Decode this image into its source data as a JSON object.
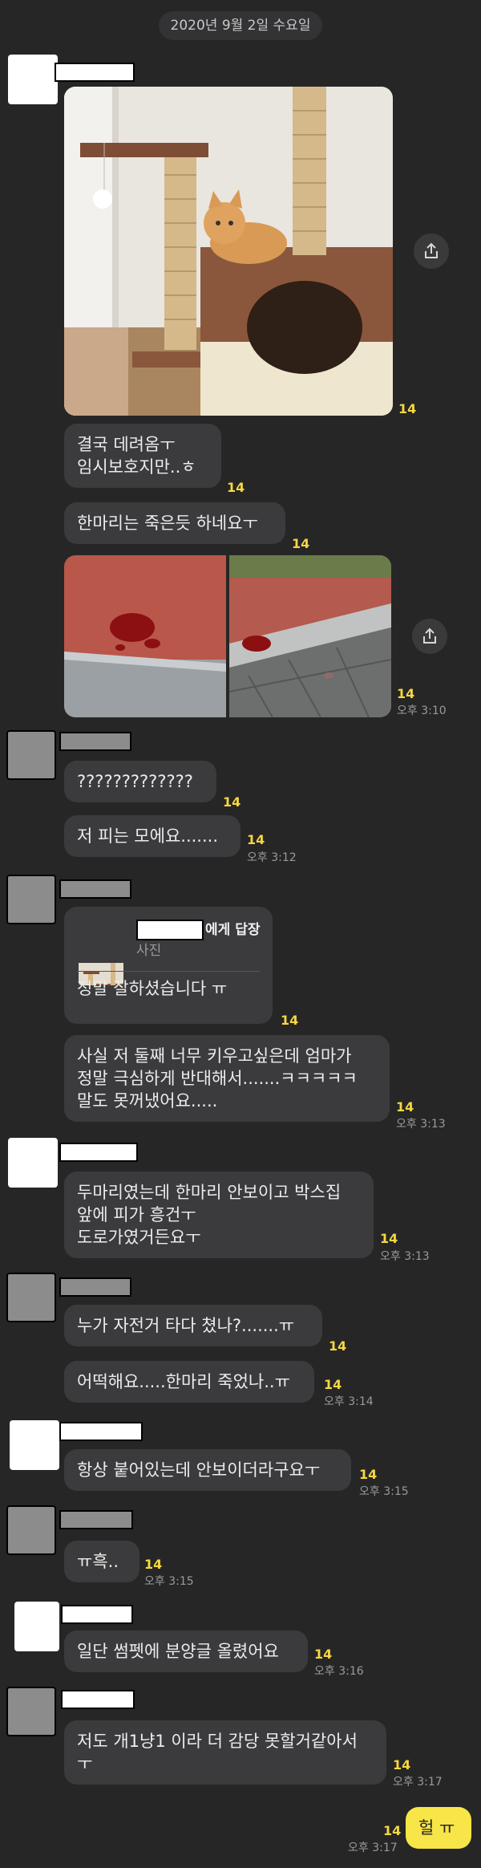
{
  "date_divider": "2020년 9월 2일 수요일",
  "messages": [
    {
      "text": "결국 데려옴ㅜ\n임시보호지만..ㅎ",
      "count": "14"
    },
    {
      "text": "한마리는 죽은듯 하네요ㅜ",
      "count": "14"
    },
    {
      "text": "?????????????",
      "count": "14"
    },
    {
      "text": "저 피는 모에요.......",
      "count": "14",
      "time": "오후 3:12"
    },
    {
      "text": "정말 잘하셨습니다 ㅠ",
      "count": "14"
    },
    {
      "text": "사실 저 둘째 너무 키우고싶은데 엄마가\n정말 극심하게 반대해서.......ㅋㅋㅋㅋㅋ\n말도 못꺼냈어요.....",
      "count": "14",
      "time": "오후 3:13"
    },
    {
      "text": "두마리였는데 한마리 안보이고 박스집\n앞에 피가 흥건ㅜ\n도로가였거든요ㅜ",
      "count": "14",
      "time": "오후 3:13"
    },
    {
      "text": "누가 자전거 타다 쳤나?.......ㅠ",
      "count": "14"
    },
    {
      "text": "어떡해요.....한마리 죽었나..ㅠ",
      "count": "14",
      "time": "오후 3:14"
    },
    {
      "text": "항상 붙어있는데 안보이더라구요ㅜ",
      "count": "14",
      "time": "오후 3:15"
    },
    {
      "text": "ㅠ흑..",
      "count": "14",
      "time": "오후 3:15"
    },
    {
      "text": "일단 썸펫에 분양글 올렸어요",
      "count": "14",
      "time": "오후 3:16"
    },
    {
      "text": "저도 개1냥1 이라 더 감당 못할거같아서\nㅜ",
      "count": "14",
      "time": "오후 3:17"
    }
  ],
  "photo1": {
    "count": "14"
  },
  "photo2": {
    "count": "14",
    "time": "오후 3:10"
  },
  "reply": {
    "to_suffix": "에게 답장",
    "type": "사진"
  },
  "mine": {
    "text": "헐 ㅠ",
    "count": "14",
    "time": "오후 3:17"
  },
  "icons": {
    "share": "share-icon"
  }
}
